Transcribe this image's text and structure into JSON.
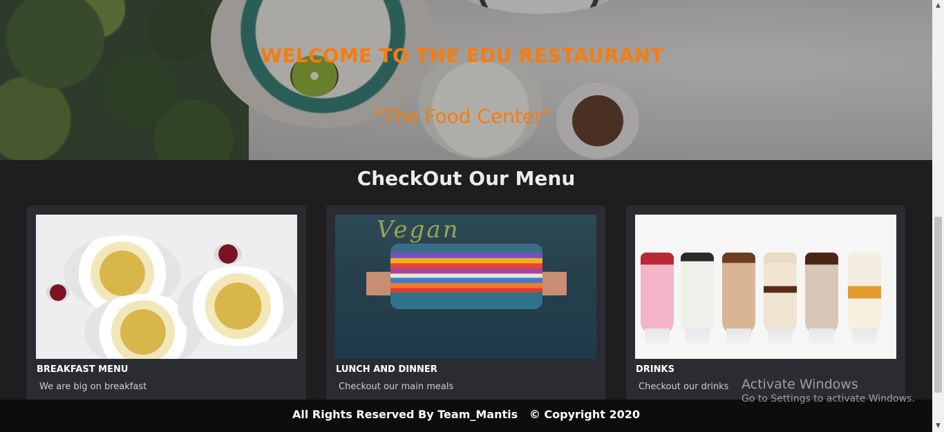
{
  "hero": {
    "title": "WELCOME TO THE EDU RESTAURANT",
    "subtitle": "\"The Food Center\"",
    "accent_color": "#f57c0f"
  },
  "menu": {
    "heading": "CheckOut Our Menu",
    "cards": [
      {
        "title": "BREAKFAST MENU",
        "description": "We are big on breakfast",
        "image": "pasta-plates-photo"
      },
      {
        "title": "LUNCH AND DINNER",
        "description": "Checkout our main meals",
        "image": "vegan-sandwich-photo"
      },
      {
        "title": "DRINKS",
        "description": "Checkout our drinks",
        "image": "milkshakes-photo"
      }
    ]
  },
  "footer": {
    "text": "All Rights Reserved By Team_Mantis   © Copyright 2020"
  },
  "watermark": {
    "line1": "Activate Windows",
    "line2": "Go to Settings to activate Windows."
  },
  "scrollbar": {
    "up_icon": "▲",
    "down_icon": "▼"
  }
}
